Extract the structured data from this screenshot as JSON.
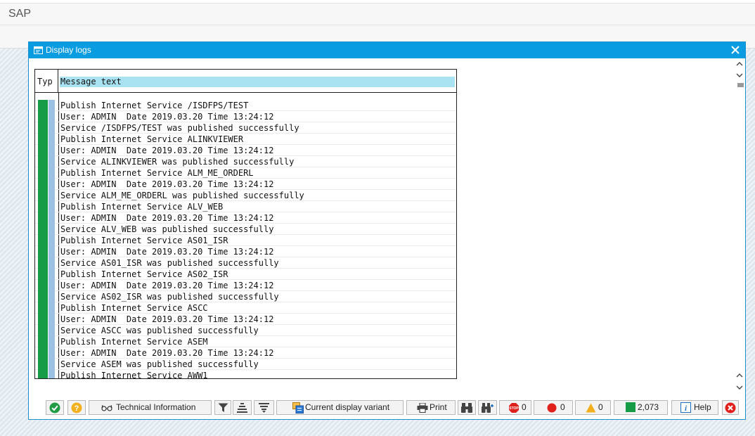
{
  "shell": {
    "title": "SAP"
  },
  "dialog": {
    "title": "Display logs",
    "columns": {
      "type": "Typ",
      "message": "Message text"
    },
    "rows": [
      "Publish Internet Service /ISDFPS/TEST",
      "User: ADMIN  Date 2019.03.20 Time 13:24:12",
      "Service /ISDFPS/TEST was published successfully",
      "Publish Internet Service ALINKVIEWER",
      "User: ADMIN  Date 2019.03.20 Time 13:24:12",
      "Service ALINKVIEWER was published successfully",
      "Publish Internet Service ALM_ME_ORDERL",
      "User: ADMIN  Date 2019.03.20 Time 13:24:12",
      "Service ALM_ME_ORDERL was published successfully",
      "Publish Internet Service ALV_WEB",
      "User: ADMIN  Date 2019.03.20 Time 13:24:12",
      "Service ALV_WEB was published successfully",
      "Publish Internet Service AS01_ISR",
      "User: ADMIN  Date 2019.03.20 Time 13:24:12",
      "Service AS01_ISR was published successfully",
      "Publish Internet Service AS02_ISR",
      "User: ADMIN  Date 2019.03.20 Time 13:24:12",
      "Service AS02_ISR was published successfully",
      "Publish Internet Service ASCC",
      "User: ADMIN  Date 2019.03.20 Time 13:24:12",
      "Service ASCC was published successfully",
      "Publish Internet Service ASEM",
      "User: ADMIN  Date 2019.03.20 Time 13:24:12",
      "Service ASEM was published successfully",
      "Publish Internet Service AWW1"
    ]
  },
  "toolbar": {
    "technical_info_label": "Technical Information",
    "display_variant_label": "Current display variant",
    "print_label": "Print",
    "stop_count": "0",
    "error_count": "0",
    "warning_count": "0",
    "success_count": "2,073",
    "help_label": "Help"
  },
  "colors": {
    "dialog_title_bar": "#0a9ce0",
    "success_green": "#169b46",
    "header_highlight": "#a9e3f2",
    "error_red": "#e0201b",
    "warning_amber": "#f2b01e"
  },
  "icons": [
    "dialog-icon",
    "close-icon",
    "ok-check-icon",
    "help-question-icon",
    "glasses-icon",
    "filter-icon",
    "sort-icon",
    "layout-icon",
    "display-variant-icon",
    "printer-icon",
    "binoculars-icon",
    "find-next-icon",
    "stop-icon",
    "error-circle-icon",
    "warning-triangle-icon",
    "success-square-icon",
    "info-icon",
    "cancel-icon",
    "scroll-up-icon",
    "scroll-down-icon"
  ]
}
